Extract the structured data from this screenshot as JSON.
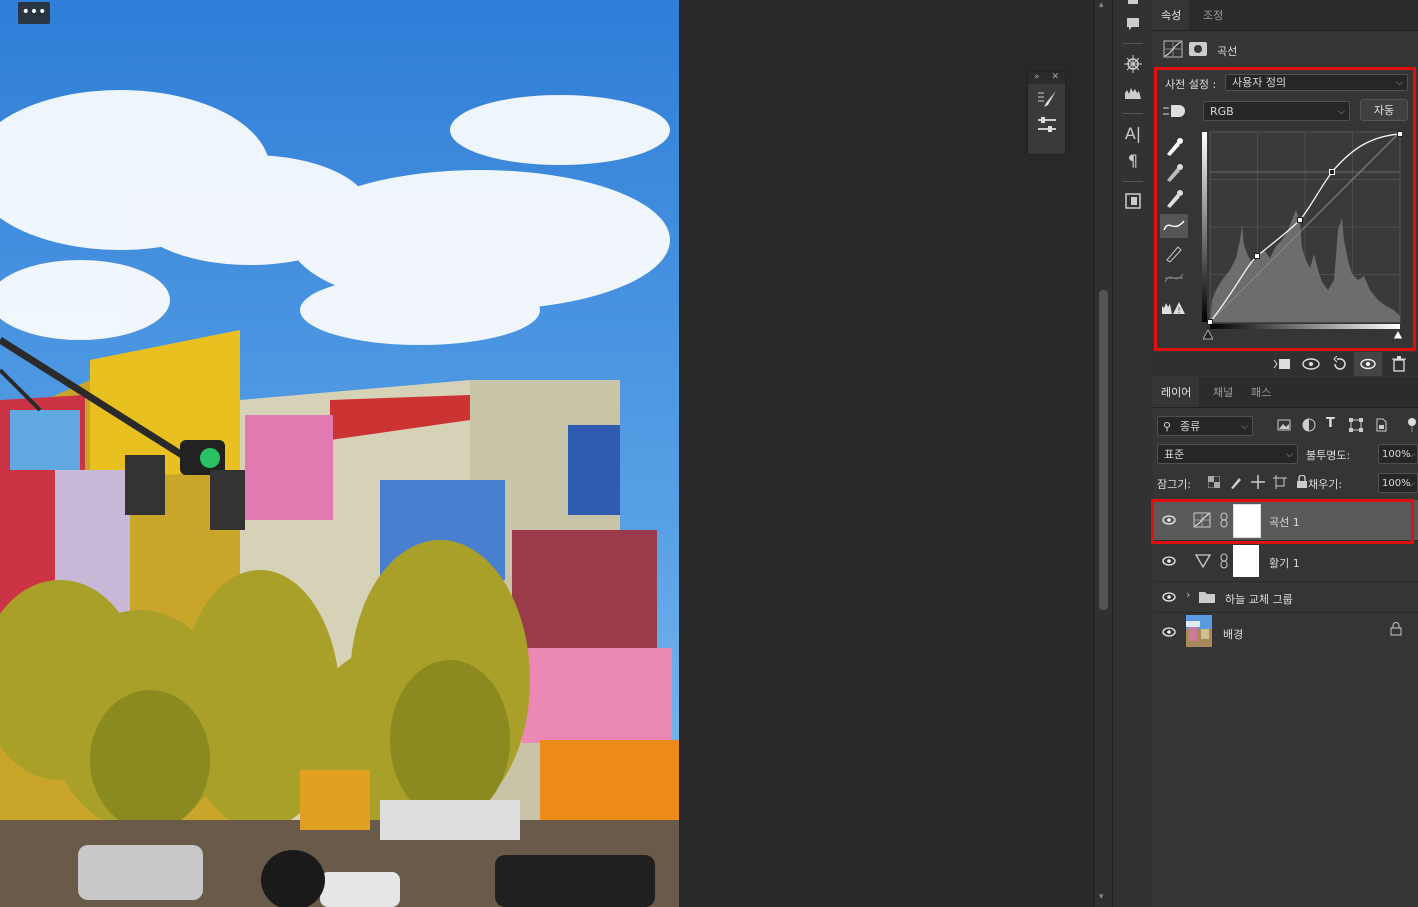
{
  "canvas": {
    "menu_label": "•••"
  },
  "properties_panel": {
    "tabs": [
      {
        "label": "속성"
      },
      {
        "label": "조정"
      }
    ],
    "title": "곡선",
    "preset_label": "사전 설정 :",
    "preset_value": "사용자 정의",
    "channel_value": "RGB",
    "auto_button": "자동"
  },
  "layers_panel": {
    "tabs": [
      {
        "label": "레이어"
      },
      {
        "label": "채널"
      },
      {
        "label": "패스"
      }
    ],
    "filter_value": "종류",
    "blend_mode": "표준",
    "opacity_label": "불투명도:",
    "opacity_value": "100%",
    "lock_label": "잠그기:",
    "fill_label": "채우기:",
    "fill_value": "100%",
    "layers": [
      {
        "name": "곡선 1",
        "type": "curves"
      },
      {
        "name": "활기 1",
        "type": "vibrance"
      },
      {
        "name": "하늘 교체 그룹",
        "type": "group"
      },
      {
        "name": "배경",
        "type": "background"
      }
    ]
  },
  "colors": {
    "highlight_red": "#e01010",
    "panel_bg": "#353535",
    "selected_layer_bg": "#5a5a5a"
  }
}
